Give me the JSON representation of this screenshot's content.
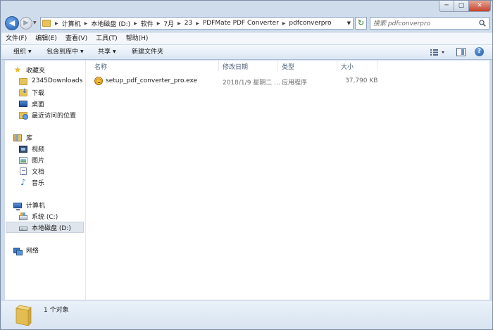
{
  "window": {
    "caption_buttons": {
      "minimize": "─",
      "maximize": "▢",
      "close": "✕"
    }
  },
  "address_bar": {
    "crumbs": [
      "计算机",
      "本地磁盘 (D:)",
      "软件",
      "7月",
      "23",
      "PDFMate PDF Converter",
      "pdfconverpro"
    ]
  },
  "search": {
    "placeholder": "搜索 pdfconverpro"
  },
  "menubar": {
    "items": [
      "文件(F)",
      "编辑(E)",
      "查看(V)",
      "工具(T)",
      "帮助(H)"
    ]
  },
  "toolbar": {
    "organize": "组织",
    "include_in_library": "包含到库中",
    "share": "共享",
    "new_folder": "新建文件夹",
    "help": "?"
  },
  "navpane": {
    "favorites": {
      "header": "收藏夹",
      "items": [
        "2345Downloads",
        "下载",
        "桌面",
        "最近访问的位置"
      ]
    },
    "libraries": {
      "header": "库",
      "items": [
        "视频",
        "图片",
        "文档",
        "音乐"
      ]
    },
    "computer": {
      "header": "计算机",
      "items": [
        "系统 (C:)",
        "本地磁盘 (D:)"
      ],
      "selected": "本地磁盘 (D:)"
    },
    "network": {
      "header": "网络"
    }
  },
  "filelist": {
    "columns": [
      "名称",
      "修改日期",
      "类型",
      "大小"
    ],
    "rows": [
      {
        "name": "setup_pdf_converter_pro.exe",
        "modified": "2018/1/9 星期二 ...",
        "type": "应用程序",
        "size": "37,790 KB"
      }
    ]
  },
  "statusbar": {
    "text": "1 个对象"
  },
  "colors": {
    "frame": "#cfdcec",
    "command_bar": "#dbe6f4",
    "header_text": "#4c607a",
    "selected_nav": "#dfe5ec",
    "close_button": "#c5422b"
  }
}
